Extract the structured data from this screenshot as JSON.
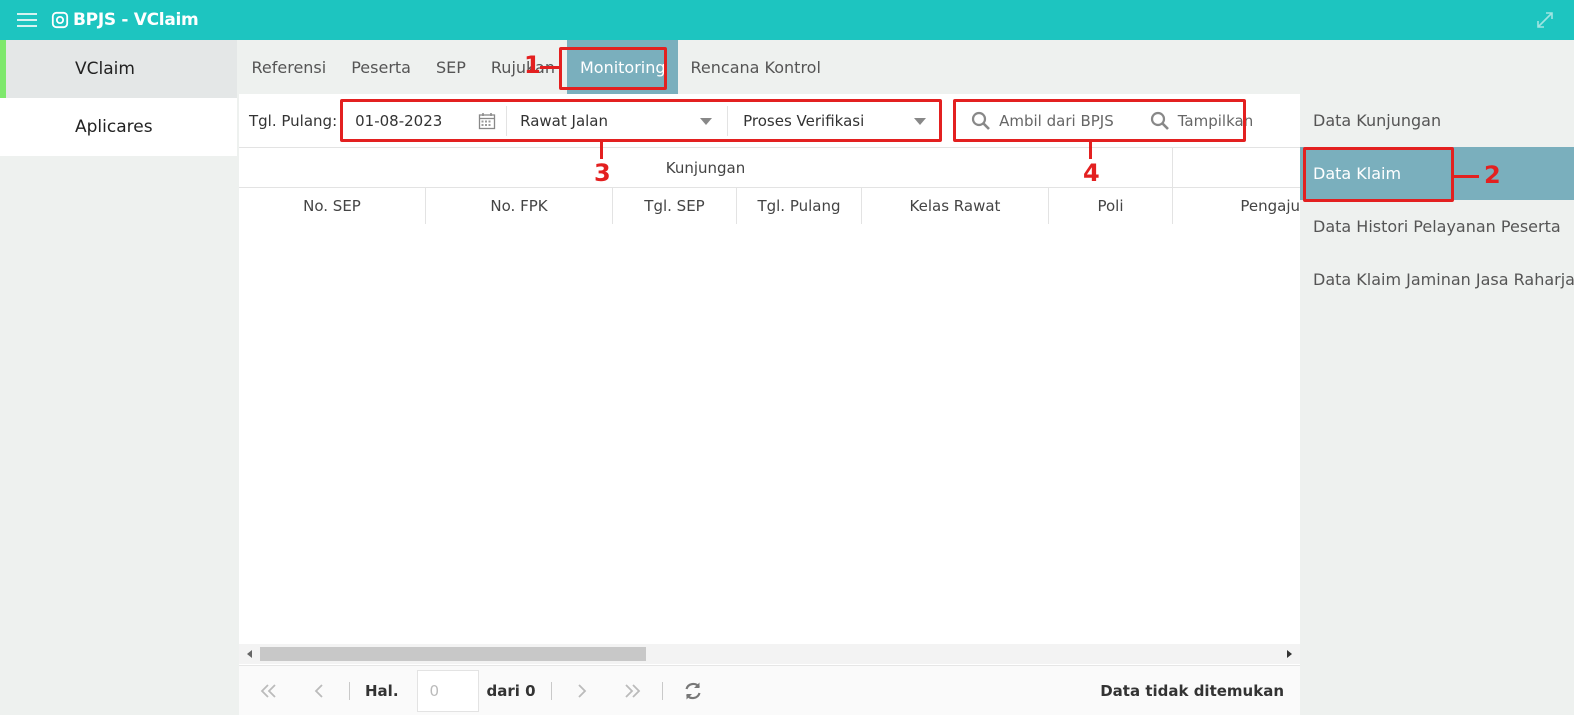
{
  "app": {
    "title": "BPJS - VClaim"
  },
  "leftnav": {
    "items": [
      {
        "label": "VClaim"
      },
      {
        "label": "Aplicares"
      }
    ]
  },
  "tabs": [
    {
      "label": "Referensi"
    },
    {
      "label": "Peserta"
    },
    {
      "label": "SEP"
    },
    {
      "label": "Rujukan"
    },
    {
      "label": "Monitoring",
      "active": true
    },
    {
      "label": "Rencana Kontrol"
    }
  ],
  "filters": {
    "tgl_label": "Tgl. Pulang:",
    "date_value": "01-08-2023",
    "jenis_pelayanan": "Rawat Jalan",
    "status_klaim": "Proses Verifikasi",
    "ambil_label": "Ambil dari BPJS",
    "tampil_label": "Tampilkan"
  },
  "grid": {
    "group_header": "Kunjungan",
    "columns": [
      "No. SEP",
      "No. FPK",
      "Tgl. SEP",
      "Tgl. Pulang",
      "Kelas Rawat",
      "Poli",
      "Pengaju"
    ]
  },
  "pager": {
    "hal_label": "Hal.",
    "page_value": "0",
    "dari_label": "dari 0",
    "status": "Data tidak ditemukan"
  },
  "rightmenu": {
    "items": [
      {
        "label": "Data Kunjungan"
      },
      {
        "label": "Data Klaim",
        "active": true
      },
      {
        "label": "Data Histori Pelayanan Peserta"
      },
      {
        "label": "Data Klaim Jaminan Jasa Raharja"
      }
    ]
  },
  "annotations": [
    "1",
    "2",
    "3",
    "4"
  ],
  "colors": {
    "header": "#1dc5c0",
    "active": "#7aafbd",
    "annotation": "#e32020",
    "nav_accent": "#7ee86c"
  }
}
